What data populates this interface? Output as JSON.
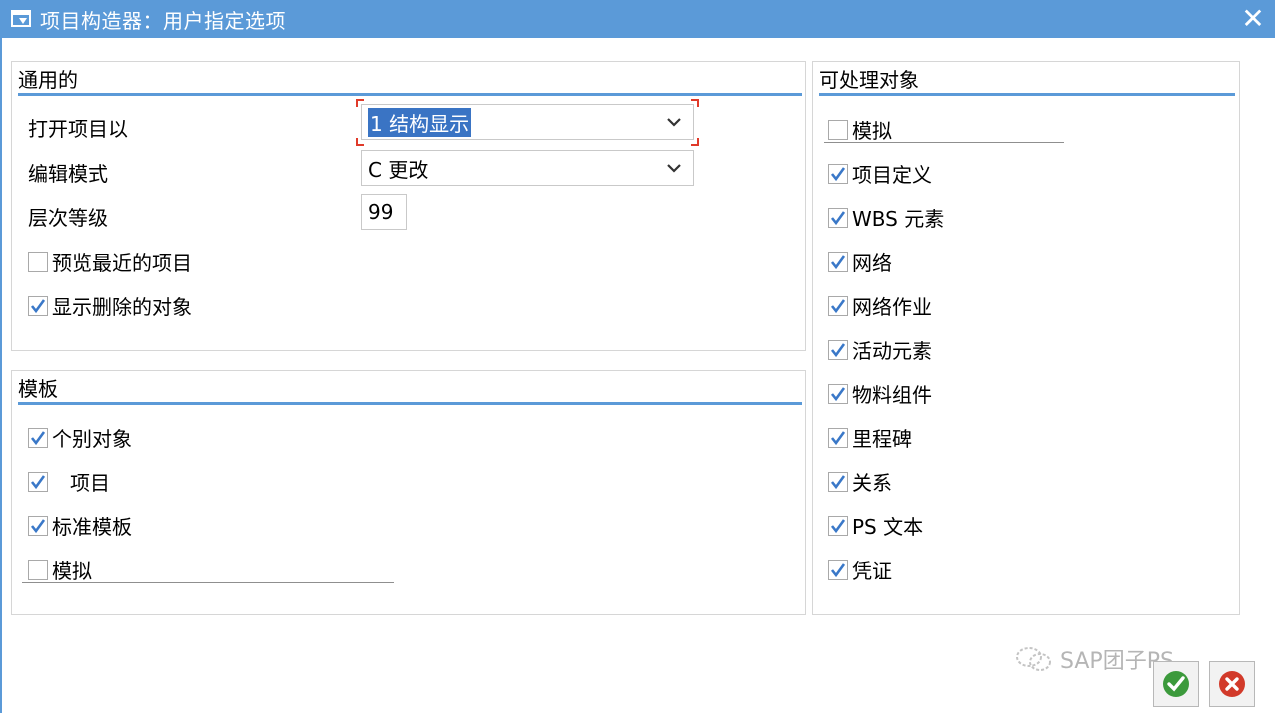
{
  "window": {
    "title": "项目构造器：用户指定选项",
    "close_glyph": "✕",
    "title_icon": "dialog-icon"
  },
  "general": {
    "title": "通用的",
    "open_project_label": "打开项目以",
    "open_project_value": "1 结构显示",
    "edit_mode_label": "编辑模式",
    "edit_mode_value": "C 更改",
    "level_label": "层次等级",
    "level_value": "99",
    "preview_recent": {
      "label": "预览最近的项目",
      "checked": false
    },
    "show_deleted": {
      "label": "显示删除的对象",
      "checked": true
    }
  },
  "template": {
    "title": "模板",
    "items": [
      {
        "label": "个别对象",
        "checked": true
      },
      {
        "label": "项目",
        "checked": true
      },
      {
        "label": "标准模板",
        "checked": true
      },
      {
        "label": "模拟",
        "checked": false
      }
    ]
  },
  "processable": {
    "title": "可处理对象",
    "items": [
      {
        "label": "模拟",
        "checked": false
      },
      {
        "label": "项目定义",
        "checked": true
      },
      {
        "label": "WBS 元素",
        "checked": true
      },
      {
        "label": "网络",
        "checked": true
      },
      {
        "label": "网络作业",
        "checked": true
      },
      {
        "label": "活动元素",
        "checked": true
      },
      {
        "label": "物料组件",
        "checked": true
      },
      {
        "label": "里程碑",
        "checked": true
      },
      {
        "label": "关系",
        "checked": true
      },
      {
        "label": "PS 文本",
        "checked": true
      },
      {
        "label": "凭证",
        "checked": true
      }
    ]
  },
  "watermark": {
    "text": "SAP团子PS"
  },
  "colors": {
    "title_bar": "#5b9ad8",
    "accent_rule": "#5b9ad8",
    "check": "#3a78c8",
    "ok_green": "#3c9a3c",
    "cancel_red": "#d23a2a"
  }
}
